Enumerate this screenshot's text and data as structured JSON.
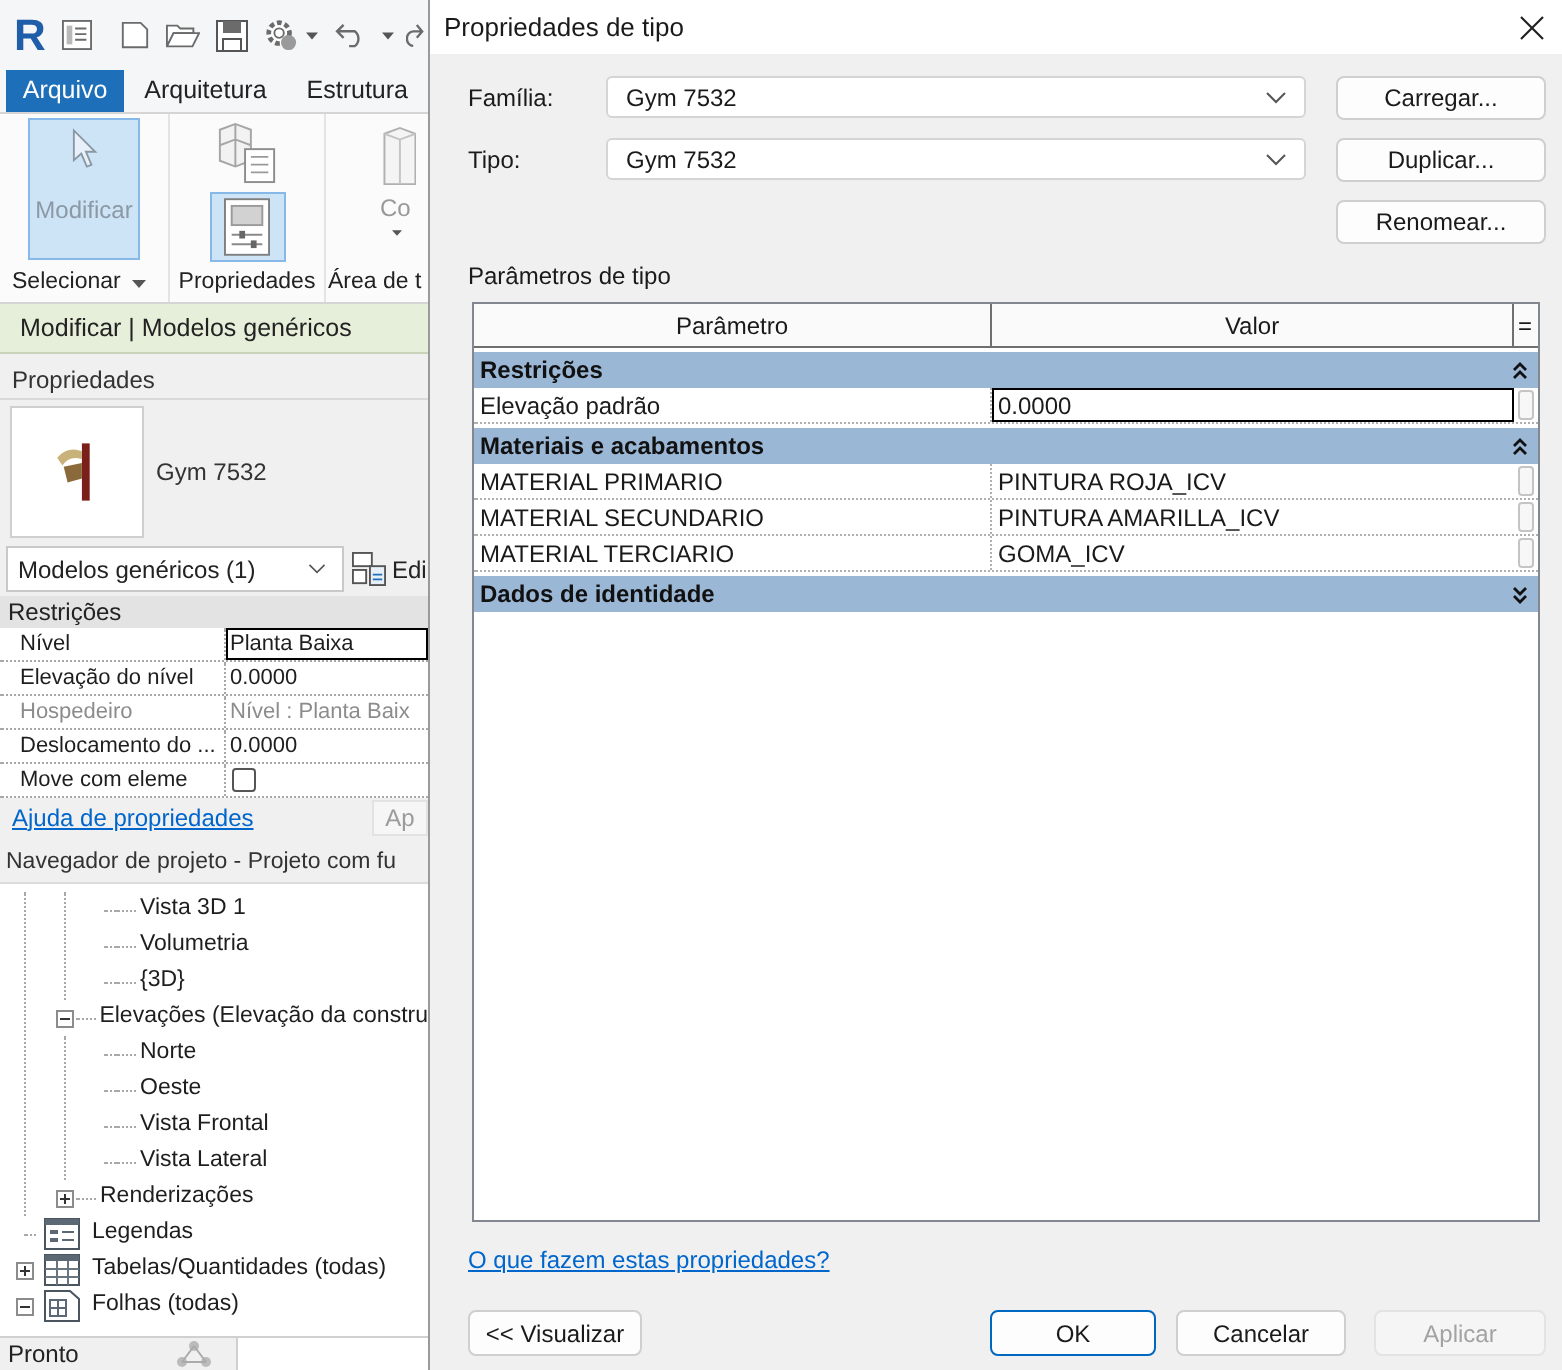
{
  "app": {
    "logo": "R",
    "ribbon_tabs": [
      {
        "label": "Arquivo",
        "kind": "application"
      },
      {
        "label": "Arquitetura",
        "kind": "tab"
      },
      {
        "label": "Estrutura",
        "kind": "tab"
      }
    ],
    "ribbon_panels": [
      {
        "label": "Selecionar",
        "dropdown": true,
        "tools": [
          {
            "kind": "select",
            "label": "Modificar",
            "selected": true
          }
        ]
      },
      {
        "label": "Propriedades",
        "dropdown": false,
        "tools": [
          {
            "kind": "type-properties",
            "selected": false
          },
          {
            "kind": "properties",
            "selected": true
          }
        ]
      },
      {
        "label": "Área de t",
        "dropdown": false,
        "tools": [
          {
            "kind": "component",
            "label": "Co",
            "selected": false
          }
        ]
      }
    ],
    "context_tab": "Modificar | Modelos genéricos"
  },
  "properties": {
    "title": "Propriedades",
    "type_name": "Gym 7532",
    "selector": "Modelos genéricos (1)",
    "edit_button": "Edi",
    "group": "Restrições",
    "rows": [
      {
        "kind": "text",
        "label": "Nível",
        "value": "Planta Baixa",
        "selected": true,
        "disabled": false
      },
      {
        "kind": "text",
        "label": "Elevação do nível",
        "value": "0.0000",
        "selected": false,
        "disabled": false
      },
      {
        "kind": "text",
        "label": "Hospedeiro",
        "value": "Nível : Planta Baix",
        "selected": false,
        "disabled": true
      },
      {
        "kind": "text",
        "label": "Deslocamento do ...",
        "value": "0.0000",
        "selected": false,
        "disabled": false
      },
      {
        "kind": "checkbox",
        "label": "Move com eleme",
        "checked": false,
        "selected": false,
        "disabled": false
      }
    ],
    "help_link": "Ajuda de propriedades",
    "apply_button": {
      "label": "Ap",
      "disabled": true
    }
  },
  "project_browser": {
    "title": "Navegador de projeto - Projeto com fu",
    "tree": [
      {
        "kind": "branch",
        "children": [
          {
            "kind": "branch",
            "children": [
              {
                "kind": "item",
                "label": "Vista 3D 1"
              },
              {
                "kind": "item",
                "label": "Volumetria"
              },
              {
                "kind": "item",
                "label": "{3D}"
              }
            ]
          },
          {
            "kind": "item",
            "label": "Elevações (Elevação da constru",
            "expanded": true,
            "children": [
              {
                "kind": "item",
                "label": "Norte"
              },
              {
                "kind": "item",
                "label": "Oeste"
              },
              {
                "kind": "item",
                "label": "Vista Frontal"
              },
              {
                "kind": "item",
                "label": "Vista Lateral"
              }
            ]
          },
          {
            "kind": "item",
            "label": "Renderizações",
            "expanded": false
          }
        ]
      },
      {
        "kind": "legend",
        "label": "Legendas"
      },
      {
        "kind": "schedule",
        "label": "Tabelas/Quantidades (todas)",
        "expanded": false
      },
      {
        "kind": "sheet",
        "label": "Folhas (todas)",
        "expanded": true
      }
    ]
  },
  "status_bar": {
    "text": "Pronto"
  },
  "dialog": {
    "title": "Propriedades de tipo",
    "fields": [
      {
        "label": "Família:",
        "value": "Gym 7532"
      },
      {
        "label": "Tipo:",
        "value": "Gym 7532"
      }
    ],
    "side_buttons": [
      "Carregar...",
      "Duplicar...",
      "Renomear..."
    ],
    "section_label": "Parâmetros de tipo",
    "table": {
      "columns": [
        "Parâmetro",
        "Valor",
        "="
      ],
      "groups": [
        {
          "name": "Restrições",
          "expanded": true,
          "rows": [
            {
              "parameter": "Elevação padrão",
              "value": "0.0000",
              "selected": true
            }
          ]
        },
        {
          "name": "Materiais e acabamentos",
          "expanded": true,
          "rows": [
            {
              "parameter": "MATERIAL PRIMARIO",
              "value": "PINTURA ROJA_ICV",
              "selected": false
            },
            {
              "parameter": "MATERIAL SECUNDARIO",
              "value": "PINTURA AMARILLA_ICV",
              "selected": false
            },
            {
              "parameter": "MATERIAL TERCIARIO",
              "value": "GOMA_ICV",
              "selected": false
            }
          ]
        },
        {
          "name": "Dados de identidade",
          "expanded": false
        }
      ]
    },
    "help_link": "O que fazem estas propriedades?",
    "preview_button": "<< Visualizar",
    "buttons": [
      {
        "label": "OK",
        "default": true,
        "disabled": false
      },
      {
        "label": "Cancelar",
        "default": false,
        "disabled": false
      },
      {
        "label": "Aplicar",
        "default": false,
        "disabled": true
      }
    ]
  }
}
